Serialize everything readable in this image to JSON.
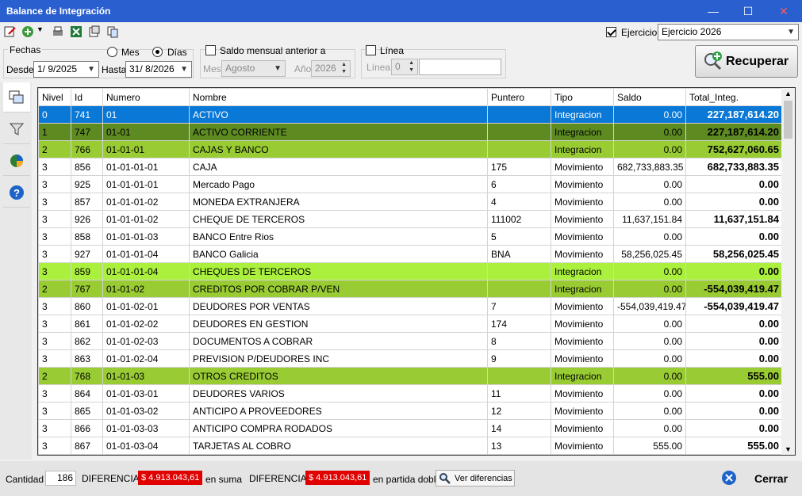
{
  "window": {
    "title": "Balance de Integración",
    "minimize": "—",
    "maximize": "☐",
    "close": "✕"
  },
  "toolbar": {
    "ejercicio_label": "Ejercicio:",
    "ejercicio_value": "Ejercicio 2026",
    "icons": [
      "edit-icon",
      "add-icon",
      "print-icon",
      "excel-icon",
      "export-icon",
      "copy-icon"
    ]
  },
  "filters": {
    "fechas_label": "Fechas",
    "mes_label": "Mes",
    "dias_label": "Días",
    "mode_selected": "Días",
    "desde_label": "Desde",
    "desde_value": "1/ 9/2025",
    "hasta_label": "Hasta",
    "hasta_value": "31/ 8/2026",
    "saldo_label": "Saldo mensual anterior a",
    "mes2_label": "Mes",
    "mes2_value": "Agosto",
    "anio_label": "Año",
    "anio_value": "2026",
    "linea_check_label": "Línea",
    "linea_label": "Línea",
    "linea_value": "0",
    "recuperar_label": "Recuperar"
  },
  "table": {
    "columns": [
      "Nivel",
      "Id",
      "Numero",
      "Nombre",
      "Puntero",
      "Tipo",
      "Saldo",
      "Total_Integ."
    ],
    "rows": [
      {
        "nivel": "0",
        "id": "741",
        "numero": "01",
        "nombre": "ACTIVO",
        "puntero": "",
        "tipo": "Integracion",
        "saldo": "0.00",
        "total": "227,187,614.20",
        "style": "selected"
      },
      {
        "nivel": "1",
        "id": "747",
        "numero": "01-01",
        "nombre": "ACTIVO CORRIENTE",
        "puntero": "",
        "tipo": "Integracion",
        "saldo": "0.00",
        "total": "227,187,614.20",
        "style": "level1"
      },
      {
        "nivel": "2",
        "id": "766",
        "numero": "01-01-01",
        "nombre": "CAJAS Y BANCO",
        "puntero": "",
        "tipo": "Integracion",
        "saldo": "0.00",
        "total": "752,627,060.65",
        "style": "level2"
      },
      {
        "nivel": "3",
        "id": "856",
        "numero": "01-01-01-01",
        "nombre": "CAJA",
        "puntero": "175",
        "tipo": "Movimiento",
        "saldo": "682,733,883.35",
        "total": "682,733,883.35",
        "style": "plain"
      },
      {
        "nivel": "3",
        "id": "925",
        "numero": "01-01-01-01",
        "nombre": "Mercado Pago",
        "puntero": "6",
        "tipo": "Movimiento",
        "saldo": "0.00",
        "total": "0.00",
        "style": "plain"
      },
      {
        "nivel": "3",
        "id": "857",
        "numero": "01-01-01-02",
        "nombre": "MONEDA EXTRANJERA",
        "puntero": "4",
        "tipo": "Movimiento",
        "saldo": "0.00",
        "total": "0.00",
        "style": "plain"
      },
      {
        "nivel": "3",
        "id": "926",
        "numero": "01-01-01-02",
        "nombre": "CHEQUE DE TERCEROS",
        "puntero": "111002",
        "tipo": "Movimiento",
        "saldo": "11,637,151.84",
        "total": "11,637,151.84",
        "style": "plain"
      },
      {
        "nivel": "3",
        "id": "858",
        "numero": "01-01-01-03",
        "nombre": "BANCO Entre Rios",
        "puntero": "5",
        "tipo": "Movimiento",
        "saldo": "0.00",
        "total": "0.00",
        "style": "plain"
      },
      {
        "nivel": "3",
        "id": "927",
        "numero": "01-01-01-04",
        "nombre": "BANCO Galicia",
        "puntero": "BNA",
        "tipo": "Movimiento",
        "saldo": "58,256,025.45",
        "total": "58,256,025.45",
        "style": "plain"
      },
      {
        "nivel": "3",
        "id": "859",
        "numero": "01-01-01-04",
        "nombre": "CHEQUES DE TERCEROS",
        "puntero": "",
        "tipo": "Integracion",
        "saldo": "0.00",
        "total": "0.00",
        "style": "level3"
      },
      {
        "nivel": "2",
        "id": "767",
        "numero": "01-01-02",
        "nombre": "CREDITOS POR COBRAR P/VEN",
        "puntero": "",
        "tipo": "Integracion",
        "saldo": "0.00",
        "total": "-554,039,419.47",
        "style": "level2"
      },
      {
        "nivel": "3",
        "id": "860",
        "numero": "01-01-02-01",
        "nombre": "DEUDORES POR VENTAS",
        "puntero": "7",
        "tipo": "Movimiento",
        "saldo": "-554,039,419.47",
        "total": "-554,039,419.47",
        "style": "plain"
      },
      {
        "nivel": "3",
        "id": "861",
        "numero": "01-01-02-02",
        "nombre": "DEUDORES EN GESTION",
        "puntero": "174",
        "tipo": "Movimiento",
        "saldo": "0.00",
        "total": "0.00",
        "style": "plain"
      },
      {
        "nivel": "3",
        "id": "862",
        "numero": "01-01-02-03",
        "nombre": "DOCUMENTOS A COBRAR",
        "puntero": "8",
        "tipo": "Movimiento",
        "saldo": "0.00",
        "total": "0.00",
        "style": "plain"
      },
      {
        "nivel": "3",
        "id": "863",
        "numero": "01-01-02-04",
        "nombre": "PREVISION P/DEUDORES INC",
        "puntero": "9",
        "tipo": "Movimiento",
        "saldo": "0.00",
        "total": "0.00",
        "style": "plain"
      },
      {
        "nivel": "2",
        "id": "768",
        "numero": "01-01-03",
        "nombre": "OTROS  CREDITOS",
        "puntero": "",
        "tipo": "Integracion",
        "saldo": "0.00",
        "total": "555.00",
        "style": "level2"
      },
      {
        "nivel": "3",
        "id": "864",
        "numero": "01-01-03-01",
        "nombre": "DEUDORES VARIOS",
        "puntero": "11",
        "tipo": "Movimiento",
        "saldo": "0.00",
        "total": "0.00",
        "style": "plain"
      },
      {
        "nivel": "3",
        "id": "865",
        "numero": "01-01-03-02",
        "nombre": "ANTICIPO A PROVEEDORES",
        "puntero": "12",
        "tipo": "Movimiento",
        "saldo": "0.00",
        "total": "0.00",
        "style": "plain"
      },
      {
        "nivel": "3",
        "id": "866",
        "numero": "01-01-03-03",
        "nombre": "ANTICIPO COMPRA RODADOS",
        "puntero": "14",
        "tipo": "Movimiento",
        "saldo": "0.00",
        "total": "0.00",
        "style": "plain"
      },
      {
        "nivel": "3",
        "id": "867",
        "numero": "01-01-03-04",
        "nombre": "TARJETAS AL COBRO",
        "puntero": "13",
        "tipo": "Movimiento",
        "saldo": "555.00",
        "total": "555.00",
        "style": "plain"
      }
    ]
  },
  "row_colors": {
    "selected": {
      "bg": "#0a78d7",
      "fg": "#ffffff"
    },
    "level1": {
      "bg": "#5e8a22",
      "fg": "#000000"
    },
    "level2": {
      "bg": "#99cc33",
      "fg": "#000000"
    },
    "level3": {
      "bg": "#aaf03c",
      "fg": "#000000"
    },
    "plain": {
      "bg": "#ffffff",
      "fg": "#000000"
    }
  },
  "status": {
    "cantidad_label": "Cantidad",
    "cantidad_value": "186",
    "diferencia1_label": "DIFERENCIA:",
    "diferencia1_value": "$ 4.913.043,61",
    "en_suma": "en suma",
    "diferencia2_label": "DIFERENCIA:",
    "diferencia2_value": "$ 4.913.043,61",
    "en_partida_doble": "en partida doble",
    "ver_diferencias": "Ver diferencias",
    "cerrar": "Cerrar"
  }
}
